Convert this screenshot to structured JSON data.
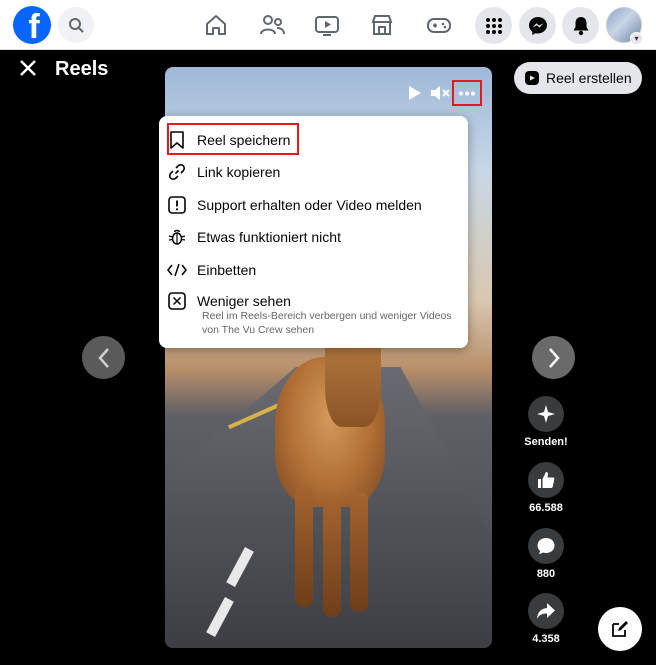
{
  "header": {
    "logo": "f",
    "nav_icons": [
      "home-icon",
      "friends-icon",
      "video-icon",
      "marketplace-icon",
      "gaming-icon"
    ],
    "right_icons": [
      "menu-grid-icon",
      "messenger-icon",
      "bell-icon"
    ]
  },
  "reels": {
    "title": "Reels",
    "create_label": "Reel erstellen"
  },
  "menu": {
    "items": [
      {
        "label": "Reel speichern",
        "icon": "bookmark-icon"
      },
      {
        "label": "Link kopieren",
        "icon": "link-icon"
      },
      {
        "label": "Support erhalten oder Video melden",
        "icon": "report-icon"
      },
      {
        "label": "Etwas funktioniert nicht",
        "icon": "bug-icon"
      },
      {
        "label": "Einbetten",
        "icon": "embed-icon"
      },
      {
        "label": "Weniger sehen",
        "icon": "hide-icon"
      }
    ],
    "less_sub": "Reel im Reels-Bereich verbergen und weniger Videos von The Vu Crew sehen"
  },
  "actions": {
    "send_label": "Senden!",
    "likes": "66.588",
    "comments": "880",
    "shares": "4.358"
  },
  "colors": {
    "brand": "#0866ff",
    "highlight": "#e01b1b"
  }
}
